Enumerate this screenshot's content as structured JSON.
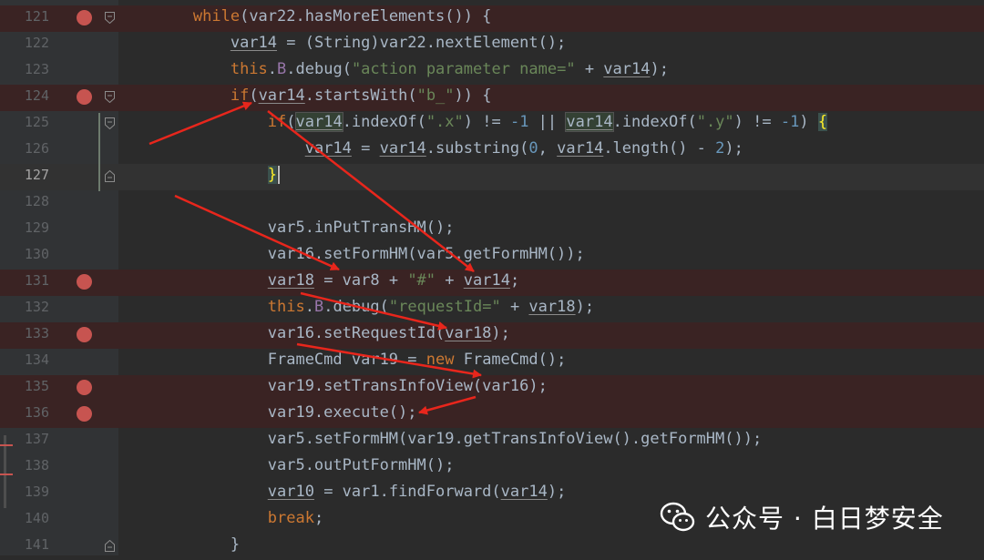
{
  "editor": {
    "lines": [
      {
        "n": "121",
        "bp": true,
        "fold": "open",
        "code": [
          [
            "        ",
            ""
          ],
          [
            "while",
            "kw"
          ],
          [
            "(var22.hasMoreElements()) {",
            ""
          ]
        ]
      },
      {
        "n": "122",
        "bp": false,
        "code": [
          [
            "            ",
            ""
          ],
          [
            "var14",
            "u"
          ],
          [
            " = (String)var22.nextElement();",
            ""
          ]
        ]
      },
      {
        "n": "123",
        "bp": false,
        "code": [
          [
            "            ",
            ""
          ],
          [
            "this",
            "kw"
          ],
          [
            ".",
            ""
          ],
          [
            "B",
            "fld"
          ],
          [
            ".debug(",
            ""
          ],
          [
            "\"action parameter name=\"",
            "str"
          ],
          [
            " + ",
            ""
          ],
          [
            "var14",
            "u"
          ],
          [
            ");",
            ""
          ]
        ]
      },
      {
        "n": "124",
        "bp": true,
        "fold": "open",
        "code": [
          [
            "            ",
            ""
          ],
          [
            "if",
            "kw"
          ],
          [
            "(",
            ""
          ],
          [
            "var14",
            "u"
          ],
          [
            ".startsWith(",
            ""
          ],
          [
            "\"b_\"",
            "str"
          ],
          [
            ")) {",
            ""
          ]
        ]
      },
      {
        "n": "125",
        "bp": false,
        "fold": "open",
        "code": [
          [
            "                ",
            ""
          ],
          [
            "if",
            "kw"
          ],
          [
            "(",
            ""
          ],
          [
            "var14",
            "u hl2"
          ],
          [
            ".indexOf(",
            ""
          ],
          [
            "\".x\"",
            "str"
          ],
          [
            ") != ",
            ""
          ],
          [
            "-1",
            "num"
          ],
          [
            " || ",
            ""
          ],
          [
            "var14",
            "u hl2"
          ],
          [
            ".indexOf(",
            ""
          ],
          [
            "\".y\"",
            "str"
          ],
          [
            ") != ",
            ""
          ],
          [
            "-1",
            "num"
          ],
          [
            ") ",
            ""
          ],
          [
            "{",
            "brace-hl"
          ]
        ]
      },
      {
        "n": "126",
        "bp": false,
        "code": [
          [
            "                    ",
            ""
          ],
          [
            "var14",
            "u"
          ],
          [
            " = ",
            ""
          ],
          [
            "var14",
            "u"
          ],
          [
            ".substring(",
            ""
          ],
          [
            "0",
            "num"
          ],
          [
            ", ",
            ""
          ],
          [
            "var14",
            "u"
          ],
          [
            ".length() - ",
            ""
          ],
          [
            "2",
            "num"
          ],
          [
            ");",
            ""
          ]
        ]
      },
      {
        "n": "127",
        "bp": false,
        "fold": "close",
        "current": true,
        "code": [
          [
            "                ",
            ""
          ],
          [
            "}",
            "brace-hl"
          ],
          [
            "CARET",
            ""
          ]
        ]
      },
      {
        "n": "128",
        "bp": false,
        "code": []
      },
      {
        "n": "129",
        "bp": false,
        "code": [
          [
            "                var5.inPutTransHM();",
            ""
          ]
        ]
      },
      {
        "n": "130",
        "bp": false,
        "code": [
          [
            "                var16.setFormHM(var5.getFormHM());",
            ""
          ]
        ]
      },
      {
        "n": "131",
        "bp": true,
        "code": [
          [
            "                ",
            ""
          ],
          [
            "var18",
            "u"
          ],
          [
            " = var8 + ",
            ""
          ],
          [
            "\"#\"",
            "str"
          ],
          [
            " + ",
            ""
          ],
          [
            "var14",
            "u"
          ],
          [
            ";",
            ""
          ]
        ]
      },
      {
        "n": "132",
        "bp": false,
        "code": [
          [
            "                ",
            ""
          ],
          [
            "this",
            "kw"
          ],
          [
            ".",
            ""
          ],
          [
            "B",
            "fld"
          ],
          [
            ".debug(",
            ""
          ],
          [
            "\"requestId=\"",
            "str"
          ],
          [
            " + ",
            ""
          ],
          [
            "var18",
            "u"
          ],
          [
            ");",
            ""
          ]
        ]
      },
      {
        "n": "133",
        "bp": true,
        "code": [
          [
            "                var16.setRequestId(",
            ""
          ],
          [
            "var18",
            "u"
          ],
          [
            ");",
            ""
          ]
        ]
      },
      {
        "n": "134",
        "bp": false,
        "code": [
          [
            "                FrameCmd var19 = ",
            ""
          ],
          [
            "new",
            "kw"
          ],
          [
            " FrameCmd();",
            ""
          ]
        ]
      },
      {
        "n": "135",
        "bp": true,
        "code": [
          [
            "                var19.setTransInfoView(var16);",
            ""
          ]
        ]
      },
      {
        "n": "136",
        "bp": true,
        "code": [
          [
            "                var19.execute();",
            ""
          ]
        ]
      },
      {
        "n": "137",
        "bp": false,
        "code": [
          [
            "                var5.setFormHM(var19.getTransInfoView().getFormHM());",
            ""
          ]
        ]
      },
      {
        "n": "138",
        "bp": false,
        "code": [
          [
            "                var5.outPutFormHM();",
            ""
          ]
        ]
      },
      {
        "n": "139",
        "bp": false,
        "code": [
          [
            "                ",
            ""
          ],
          [
            "var10",
            "u"
          ],
          [
            " = var1.findForward(",
            ""
          ],
          [
            "var14",
            "u"
          ],
          [
            ");",
            ""
          ]
        ]
      },
      {
        "n": "140",
        "bp": false,
        "code": [
          [
            "                ",
            ""
          ],
          [
            "break",
            "kw"
          ],
          [
            ";",
            ""
          ]
        ]
      },
      {
        "n": "141",
        "bp": false,
        "fold": "close",
        "code": [
          [
            "            }",
            ""
          ]
        ]
      }
    ]
  },
  "watermark": {
    "icon": "wechat-icon",
    "text": "公众号 · 白日梦安全"
  },
  "colors": {
    "background": "#2b2b2b",
    "gutter": "#313335",
    "breakpoint": "#c75450",
    "keyword": "#cc7832",
    "string": "#6a8759",
    "number": "#6897bb",
    "field": "#9876aa",
    "text": "#a9b7c6",
    "arrow": "#e8261c"
  }
}
